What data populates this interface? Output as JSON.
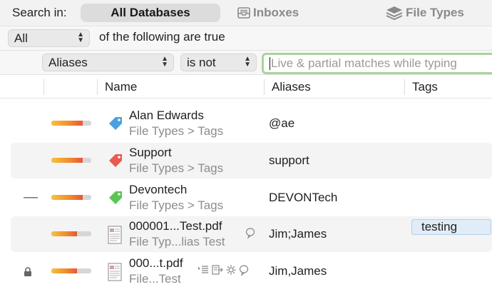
{
  "scope": {
    "label": "Search in:",
    "options": [
      {
        "label": "All Databases",
        "selected": true
      },
      {
        "label": "Inboxes",
        "icon": "inbox-icon"
      },
      {
        "label": "File Types",
        "icon": "stack-icon"
      }
    ]
  },
  "condition": {
    "quantifier": "All",
    "text": "of the following are true"
  },
  "criteria": {
    "field": "Aliases",
    "operator": "is not",
    "placeholder": "Live & partial matches while typing"
  },
  "columns": {
    "name": "Name",
    "aliases": "Aliases",
    "tags": "Tags"
  },
  "colors": {
    "accent_focus": "#a7d59a",
    "tag_blue": "#4aa0e0",
    "tag_red": "#ea5a4f",
    "tag_green": "#5bc653",
    "tag_badge_bg": "#e0ecf7"
  },
  "rows": [
    {
      "name": "Alan Edwards",
      "path": "File Types > Tags",
      "aliases": "@ae",
      "icon": "blue-tag-icon",
      "rating": 0.78
    },
    {
      "name": "Support",
      "path": "File Types > Tags",
      "aliases": "support",
      "icon": "red-tag-icon",
      "rating": 0.78
    },
    {
      "name": "Devontech",
      "path": "File Types > Tags",
      "aliases": "DEVONTech",
      "icon": "green-tag-icon",
      "rating": 0.78,
      "lead": "dash"
    },
    {
      "name": "000001...Test.pdf",
      "path": "File Typ...lias Test",
      "aliases": "Jim;James",
      "icon": "pdf-document-icon",
      "rating": 0.64,
      "tag": "testing"
    },
    {
      "name": "000...t.pdf",
      "path": "File...Test",
      "aliases": "Jim,James",
      "icon": "pdf-document-icon",
      "rating": 0.64,
      "lead": "lock"
    }
  ]
}
